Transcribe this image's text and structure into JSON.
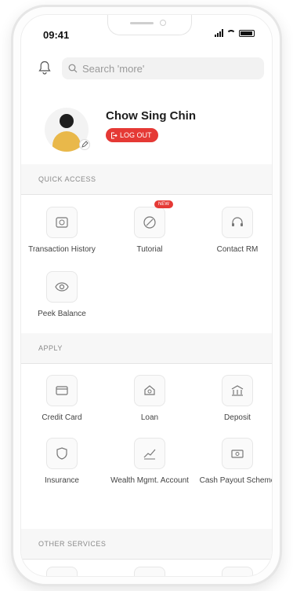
{
  "status": {
    "time": "09:41"
  },
  "search": {
    "placeholder": "Search 'more'"
  },
  "profile": {
    "name": "Chow Sing Chin",
    "logout_label": "LOG OUT"
  },
  "quick_access": {
    "title": "QUICK ACCESS",
    "items": [
      {
        "label": "Transaction History",
        "icon": "transaction-history-icon"
      },
      {
        "label": "Tutorial",
        "icon": "tutorial-icon",
        "badge": "NEW"
      },
      {
        "label": "Contact RM",
        "icon": "headset-icon"
      },
      {
        "label": "Peek Balance",
        "icon": "eye-icon"
      }
    ]
  },
  "apply": {
    "title": "APPLY",
    "items": [
      {
        "label": "Credit Card",
        "icon": "credit-card-icon"
      },
      {
        "label": "Loan",
        "icon": "loan-icon"
      },
      {
        "label": "Deposit",
        "icon": "deposit-icon"
      },
      {
        "label": "Insurance",
        "icon": "shield-icon"
      },
      {
        "label": "Wealth Mgmt. Account",
        "icon": "wealth-icon"
      },
      {
        "label": "Cash Payout Scheme",
        "icon": "cash-icon"
      }
    ]
  },
  "other_services": {
    "title": "OTHER SERVICES"
  },
  "colors": {
    "accent": "#e53935",
    "avatar_body": "#e9b84a"
  }
}
